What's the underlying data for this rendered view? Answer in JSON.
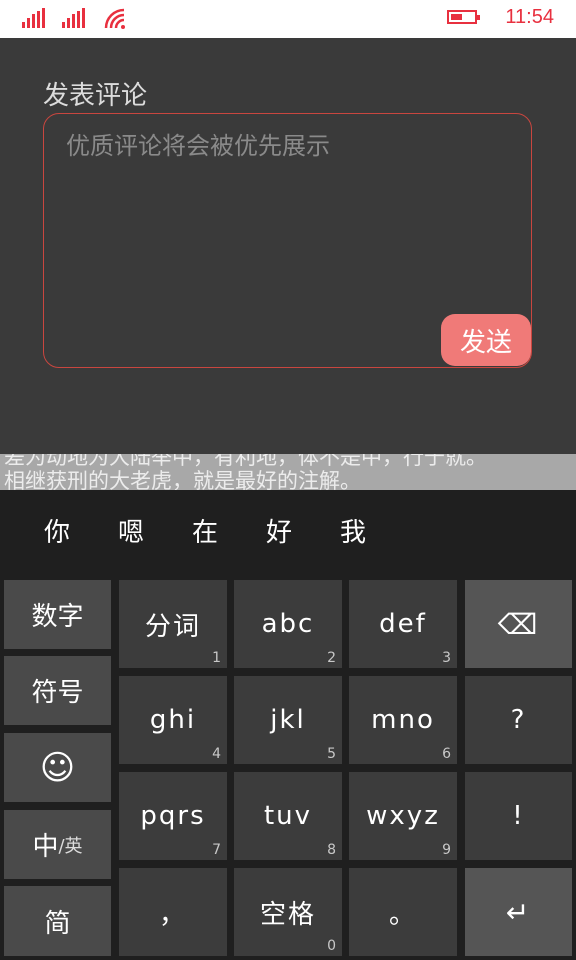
{
  "status_bar": {
    "time": "11:54",
    "icons": [
      "signal-icon",
      "signal-icon",
      "wifi-icon",
      "battery-icon"
    ],
    "accent_color": "#e8303f"
  },
  "comment": {
    "title": "发表评论",
    "placeholder": "优质评论将会被优先展示",
    "send_label": "发送",
    "send_color": "#f07a78"
  },
  "background_article": {
    "line1": "差为动地为大陆举中，有利地，体不是中，行于就。",
    "line2": "相继获刑的大老虎，就是最好的注解。"
  },
  "candidates": [
    "你",
    "嗯",
    "在",
    "好",
    "我"
  ],
  "keyboard": {
    "side_keys": [
      "数字",
      "符号",
      "smiley",
      "中",
      "英",
      "简"
    ],
    "side_smiley": "☺",
    "side_lang_main": "中",
    "side_lang_sub": "/英",
    "rows": [
      [
        {
          "label": "分词",
          "num": "1"
        },
        {
          "label": "abc",
          "num": "2"
        },
        {
          "label": "def",
          "num": "3"
        }
      ],
      [
        {
          "label": "ghi",
          "num": "4"
        },
        {
          "label": "jkl",
          "num": "5"
        },
        {
          "label": "mno",
          "num": "6"
        }
      ],
      [
        {
          "label": "pqrs",
          "num": "7"
        },
        {
          "label": "tuv",
          "num": "8"
        },
        {
          "label": "wxyz",
          "num": "9"
        }
      ],
      [
        {
          "label": "，",
          "num": ""
        },
        {
          "label": "空格",
          "num": "0"
        },
        {
          "label": "。",
          "num": ""
        }
      ]
    ],
    "right_keys": {
      "backspace": "⌫",
      "question": "?",
      "exclaim": "!",
      "enter": "↵"
    }
  }
}
